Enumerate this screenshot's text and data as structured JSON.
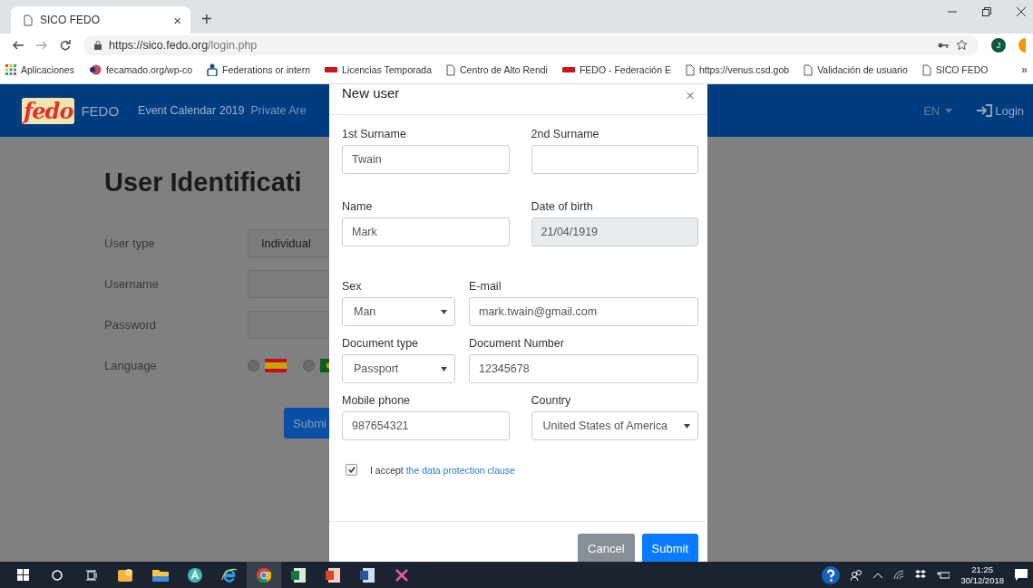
{
  "browser": {
    "tab_title": "SICO FEDO",
    "tab_close": "×",
    "new_tab": "+",
    "url_host": "https://sico.fedo.org",
    "url_path": "/login.php",
    "profile_initial": "J",
    "bookmarks_more": "»",
    "bookmarks": [
      {
        "label": "Aplicaciones",
        "kind": "apps"
      },
      {
        "label": "fecamado.org/wp-co",
        "kind": "site"
      },
      {
        "label": "Federations or intern",
        "kind": "federation"
      },
      {
        "label": "Licencias Temporada",
        "kind": "fedo"
      },
      {
        "label": "Centro de Alto Rendi",
        "kind": "page"
      },
      {
        "label": "FEDO - Federación E",
        "kind": "fedo"
      },
      {
        "label": "https://venus.csd.gob",
        "kind": "page"
      },
      {
        "label": "Validación de usuario",
        "kind": "page"
      },
      {
        "label": "SICO FEDO",
        "kind": "page"
      }
    ]
  },
  "navbar": {
    "logo": "fedo",
    "brand": "FEDO",
    "links": [
      "Event Calendar 2019",
      "Private Are"
    ],
    "language": "EN",
    "login": "Login"
  },
  "login_form": {
    "heading": "User Identificati",
    "rows": [
      {
        "label": "User type",
        "kind": "select",
        "value": "Individual"
      },
      {
        "label": "Username",
        "kind": "input"
      },
      {
        "label": "Password",
        "kind": "input"
      },
      {
        "label": "Language",
        "kind": "flags",
        "options": [
          {
            "selected": false,
            "kind": "es"
          },
          {
            "selected": false,
            "kind": "pt"
          }
        ]
      }
    ],
    "submit": "Submi"
  },
  "modal": {
    "title": "New user",
    "close": "×",
    "rows": [
      [
        {
          "label": "1st Surname",
          "kind": "input",
          "value": "Twain"
        },
        {
          "label": "2nd Surname",
          "kind": "input"
        }
      ],
      [
        {
          "label": "Name",
          "kind": "input",
          "value": "Mark"
        },
        {
          "label": "Date of birth",
          "kind": "input",
          "value": "21/04/1919",
          "disabled": true
        }
      ],
      [
        {
          "label": "Sex",
          "kind": "select",
          "value": "Man"
        },
        {
          "label": "E-mail",
          "kind": "input",
          "value": "mark.twain@gmail.com"
        }
      ],
      [
        {
          "label": "Document type",
          "kind": "select",
          "value": "Passport"
        },
        {
          "label": "Document Number",
          "kind": "input",
          "value": "12345678"
        }
      ],
      [
        {
          "label": "Mobile phone",
          "kind": "input",
          "value": "987654321"
        },
        {
          "label": "Country",
          "kind": "select",
          "value": "United States of America"
        }
      ]
    ],
    "consent": {
      "checked": true,
      "text": "I accept",
      "link": "the data protection clause"
    },
    "cancel": "Cancel",
    "submit": "Submit"
  },
  "taskbar": {
    "time": "21:25",
    "date": "30/12/2018"
  }
}
